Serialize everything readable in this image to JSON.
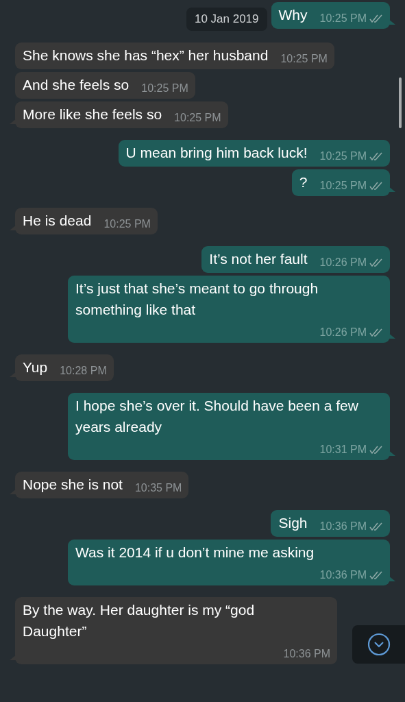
{
  "date_chip": "10 Jan 2019",
  "messages": [
    {
      "kind": "outgoing",
      "text": "Why",
      "time": "10:25 PM",
      "read": false
    },
    {
      "kind": "incoming",
      "text": "She knows she has “hex” her husband",
      "time": "10:25 PM"
    },
    {
      "kind": "incoming",
      "text": "And she feels so",
      "time": "10:25 PM"
    },
    {
      "kind": "incoming",
      "text": "More like she feels so",
      "time": "10:25 PM"
    },
    {
      "kind": "outgoing",
      "text": "U mean bring him back luck!",
      "time": "10:25 PM",
      "read": false
    },
    {
      "kind": "outgoing",
      "text": "?",
      "time": "10:25 PM",
      "read": false
    },
    {
      "kind": "incoming",
      "text": "He is dead",
      "time": "10:25 PM"
    },
    {
      "kind": "outgoing",
      "text": "It’s not her fault",
      "time": "10:26 PM",
      "read": false
    },
    {
      "kind": "outgoing",
      "text": "It’s just that she’s meant to go through something like that",
      "time": "10:26 PM",
      "read": false
    },
    {
      "kind": "incoming",
      "text": "Yup",
      "time": "10:28 PM"
    },
    {
      "kind": "outgoing",
      "text": "I hope she’s over it. Should have been a few years already",
      "time": "10:31 PM",
      "read": false
    },
    {
      "kind": "incoming",
      "text": "Nope she is not",
      "time": "10:35 PM"
    },
    {
      "kind": "outgoing",
      "text": "Sigh",
      "time": "10:36 PM",
      "read": false
    },
    {
      "kind": "outgoing",
      "text": "Was it 2014 if u don’t mine me asking",
      "time": "10:36 PM",
      "read": false
    },
    {
      "kind": "incoming",
      "text": "By the way. Her daughter is my “god Daughter”",
      "time": "10:36 PM"
    }
  ]
}
